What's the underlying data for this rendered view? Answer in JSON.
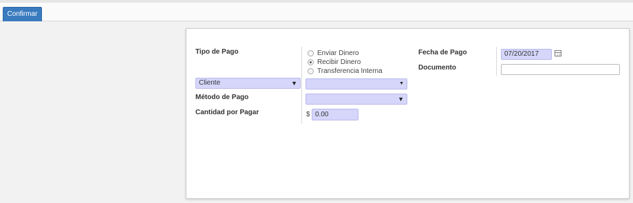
{
  "toolbar": {
    "confirm_label": "Confirmar"
  },
  "form": {
    "tipo_pago_label": "Tipo de Pago",
    "payment_type_options": [
      {
        "label": "Enviar Dinero",
        "checked": false
      },
      {
        "label": "Recibir Dinero",
        "checked": true
      },
      {
        "label": "Transferencia Interna",
        "checked": false
      }
    ],
    "partner_type_value": "Cliente",
    "partner_value": "",
    "metodo_pago_label": "Método de Pago",
    "metodo_pago_value": "",
    "cantidad_label": "Cantidad por Pagar",
    "currency_symbol": "$",
    "cantidad_value": "0.00",
    "fecha_pago_label": "Fecha de Pago",
    "fecha_pago_value": "07/20/2017",
    "documento_label": "Documento",
    "documento_value": ""
  },
  "icons": {
    "dropdown": "caret-down-icon",
    "calendar": "calendar-icon"
  },
  "colors": {
    "primary_button": "#3a7bbf",
    "required_field": "#d6d6fb"
  }
}
